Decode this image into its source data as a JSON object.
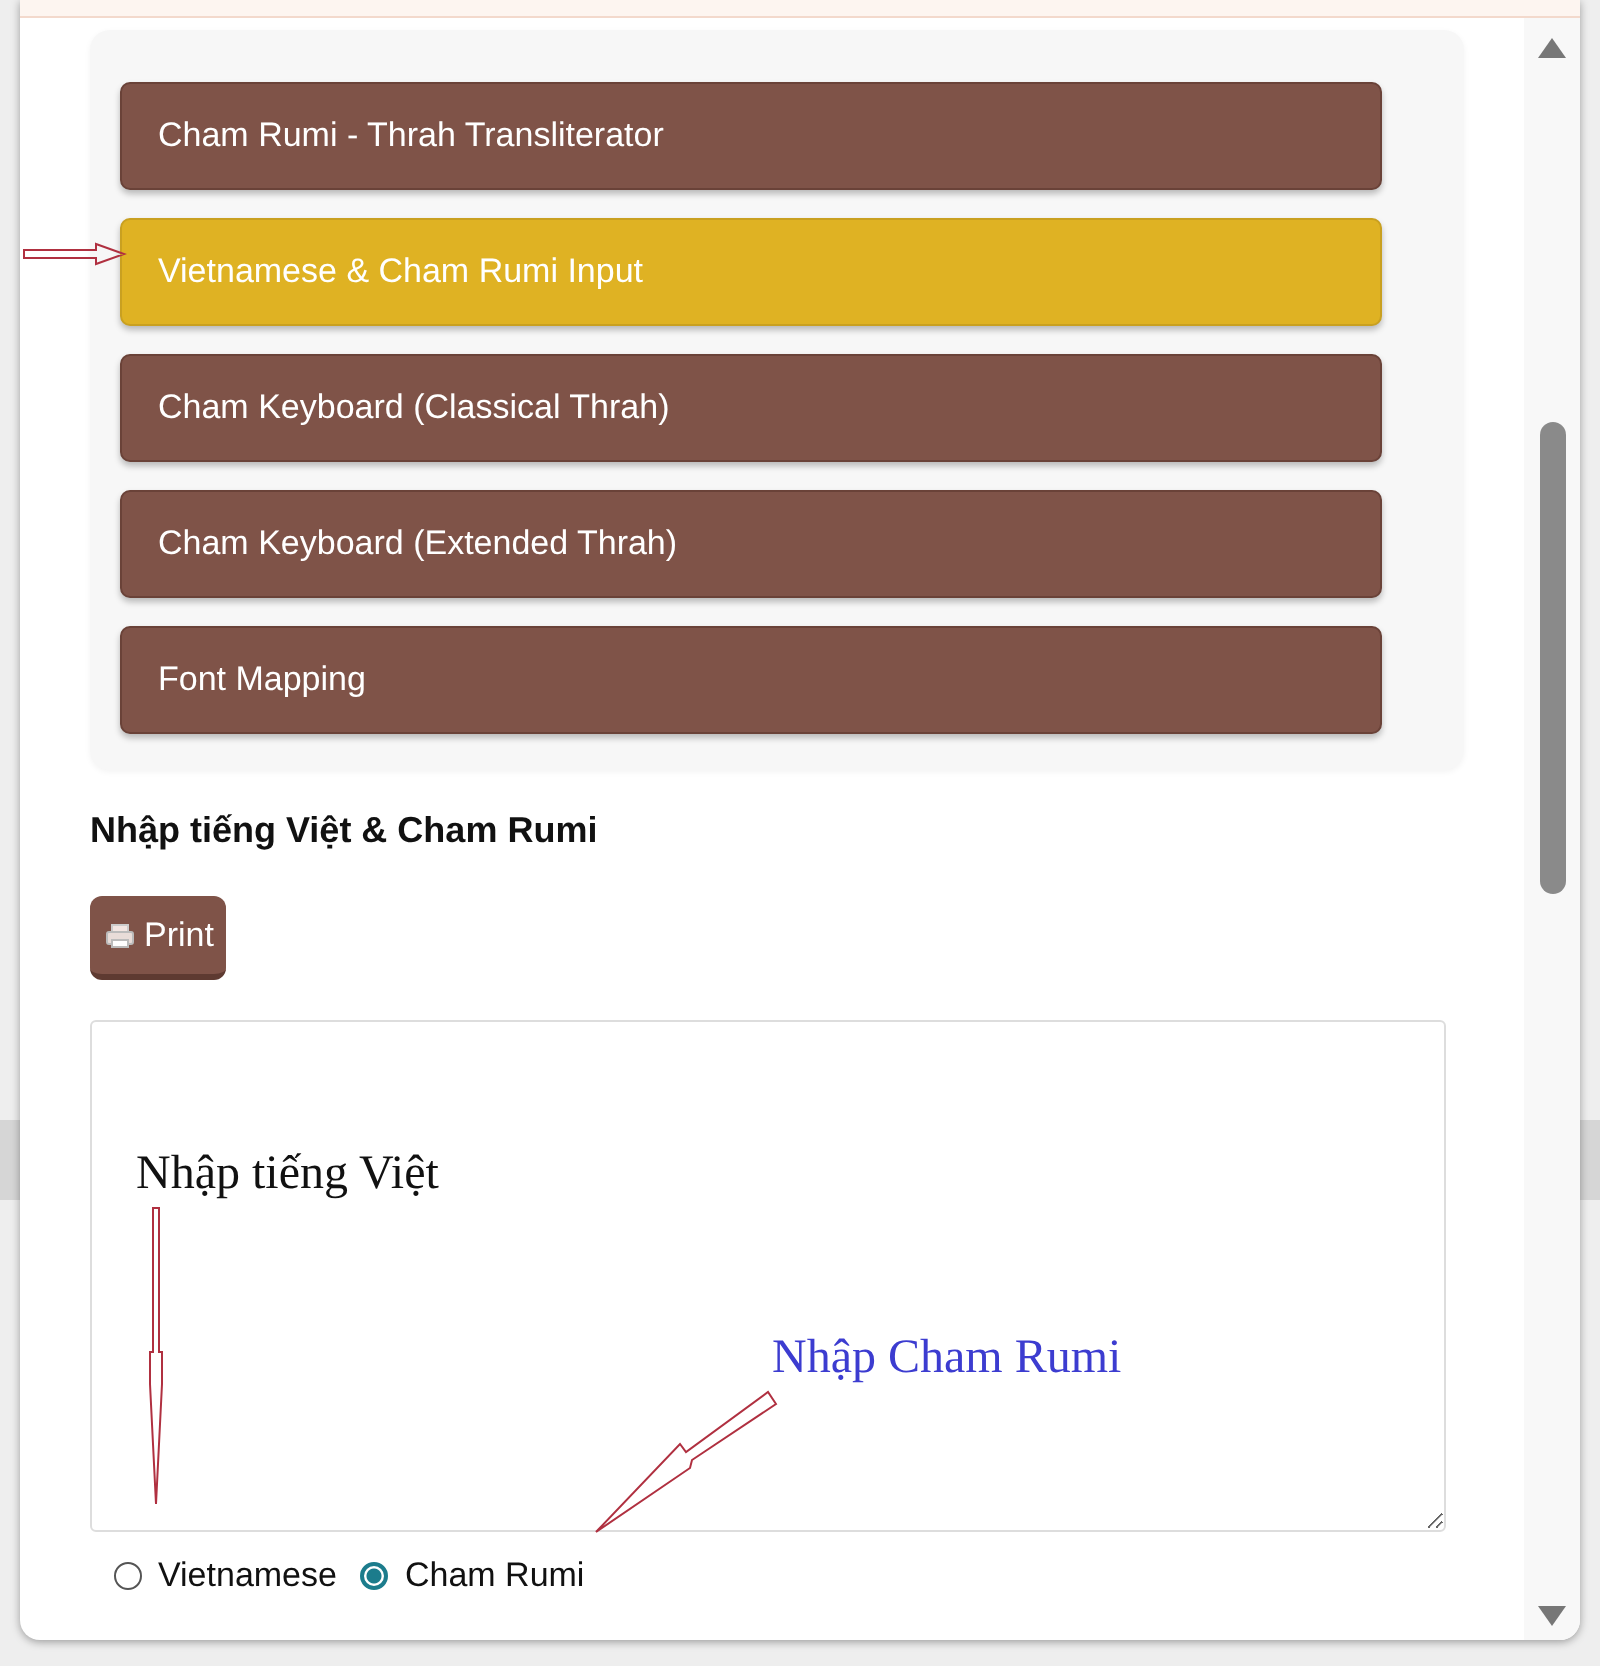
{
  "nav_items": [
    {
      "label": "Cham Rumi - Thrah Transliterator",
      "selected": false
    },
    {
      "label": "Vietnamese & Cham Rumi Input",
      "selected": true
    },
    {
      "label": "Cham Keyboard (Classical Thrah)",
      "selected": false
    },
    {
      "label": "Cham Keyboard (Extended Thrah)",
      "selected": false
    },
    {
      "label": "Font Mapping",
      "selected": false
    }
  ],
  "heading": "Nhập tiếng Việt & Cham Rumi",
  "print_button": {
    "label": "Print"
  },
  "input_modes": [
    {
      "label": "Vietnamese",
      "selected": false
    },
    {
      "label": "Cham Rumi",
      "selected": true
    }
  ],
  "annotations": [
    {
      "text": "Nhập tiếng Việt",
      "color": "#111111"
    },
    {
      "text": "Nhập Cham Rumi",
      "color": "#3c3cd0"
    }
  ]
}
